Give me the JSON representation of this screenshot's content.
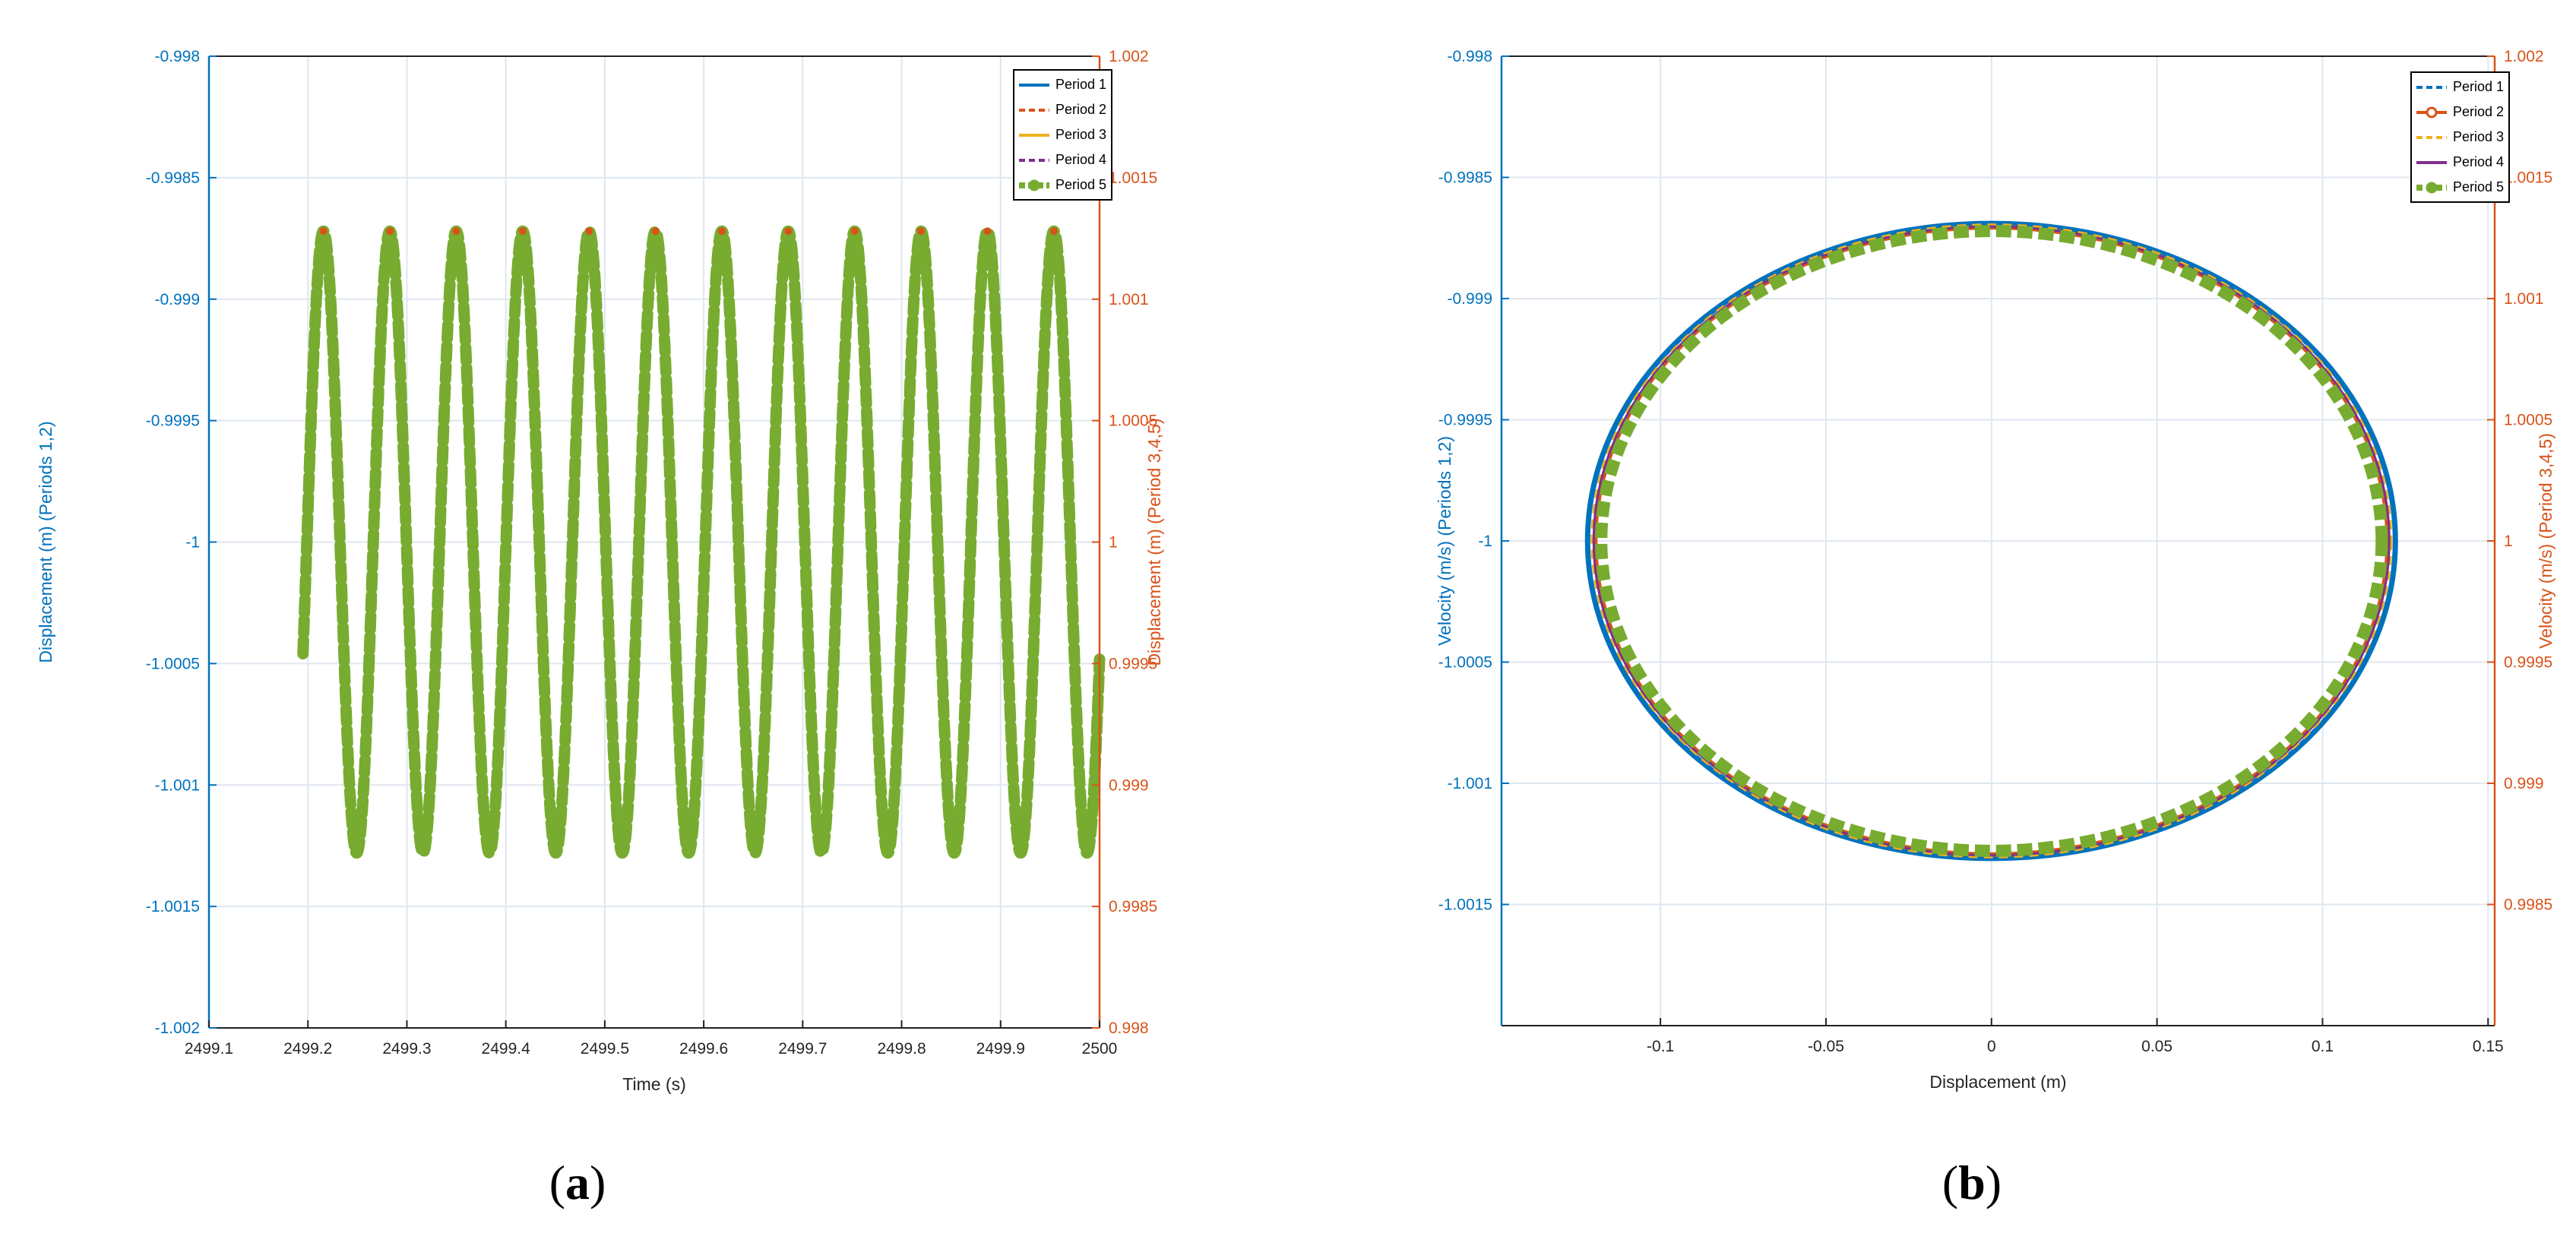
{
  "colors": {
    "period1": "#0072BD",
    "period2": "#D95319",
    "period3": "#EDB120",
    "period4": "#7E2F8E",
    "period5": "#77AC30",
    "left_axis": "#0072BD",
    "right_axis": "#D95319",
    "grid": "#dfe7ef"
  },
  "panel_a": {
    "caption": "a",
    "legend": [
      "Period 1",
      "Period 2",
      "Period 3",
      "Period 4",
      "Period 5"
    ],
    "chart_data": {
      "type": "line",
      "xlabel": "Time (s)",
      "ylabel_left": "Displacement (m) (Periods 1,2)",
      "ylabel_right": "Displacement (m) (Period 3,4,5)",
      "xlim": [
        2499.1,
        2500
      ],
      "ylim_left": [
        -1.002,
        -0.998
      ],
      "ylim_right": [
        0.998,
        1.002
      ],
      "x_ticks": [
        "2499.1",
        "2499.2",
        "2499.3",
        "2499.4",
        "2499.5",
        "2499.6",
        "2499.7",
        "2499.8",
        "2499.9",
        "2500"
      ],
      "y_ticks_left": [
        "-1.002",
        "-1.0015",
        "-1.001",
        "-1.0005",
        "-1",
        "-0.9995",
        "-0.999",
        "-0.9985",
        "-0.998"
      ],
      "y_ticks_right": [
        "0.998",
        "0.9985",
        "0.999",
        "0.9995",
        "1",
        "1.0005",
        "1.001",
        "1.0015",
        "1.002"
      ],
      "grid": true,
      "legend_position": "top-right",
      "series_shape": "sinusoid",
      "t_start": 2499.195,
      "t_end": 2500,
      "y_at_start": -1.00041,
      "peaks_x": [
        2499.2157,
        2499.2828,
        2499.3499,
        2499.417,
        2499.4841,
        2499.5512,
        2499.6183,
        2499.6854,
        2499.7525,
        2499.8196,
        2499.8867,
        2499.9538
      ],
      "y_max": -0.99872,
      "y_min": -1.00128,
      "series": [
        {
          "name": "Period 1",
          "axis": "left"
        },
        {
          "name": "Period 2",
          "axis": "left"
        },
        {
          "name": "Period 3",
          "axis": "right"
        },
        {
          "name": "Period 4",
          "axis": "right"
        },
        {
          "name": "Period 5",
          "axis": "right"
        }
      ]
    }
  },
  "panel_b": {
    "caption": "b",
    "legend": [
      "Period 1",
      "Period 2",
      "Period 3",
      "Period 4",
      "Period 5"
    ],
    "chart_data": {
      "type": "line",
      "xlabel": "Displacement (m)",
      "ylabel_left": "Velocity (m/s) (Periods 1,2)",
      "ylabel_right": "Velocity (m/s) (Period 3,4,5)",
      "xlim": [
        -0.148,
        0.152
      ],
      "ylim_left": [
        -1.002,
        -0.998
      ],
      "ylim_right": [
        0.998,
        1.002
      ],
      "x_ticks": [
        "-0.1",
        "-0.05",
        "0",
        "0.05",
        "0.1",
        "0.15"
      ],
      "y_ticks_left": [
        "-1.0015",
        "-1.001",
        "-1.0005",
        "-1",
        "-0.9995",
        "-0.999",
        "-0.9985",
        "-0.998"
      ],
      "y_ticks_right": [
        "0.9985",
        "0.999",
        "0.9995",
        "1",
        "1.0005",
        "1.001",
        "1.0015",
        "1.002"
      ],
      "grid": true,
      "legend_position": "top-right",
      "series_shape": "ellipse",
      "center": [
        0,
        -1
      ],
      "x_radius": 0.122,
      "y_radius": 0.00131,
      "series": [
        {
          "name": "Period 1",
          "axis": "left"
        },
        {
          "name": "Period 2",
          "axis": "left"
        },
        {
          "name": "Period 3",
          "axis": "right"
        },
        {
          "name": "Period 4",
          "axis": "right"
        },
        {
          "name": "Period 5",
          "axis": "right"
        }
      ]
    }
  }
}
